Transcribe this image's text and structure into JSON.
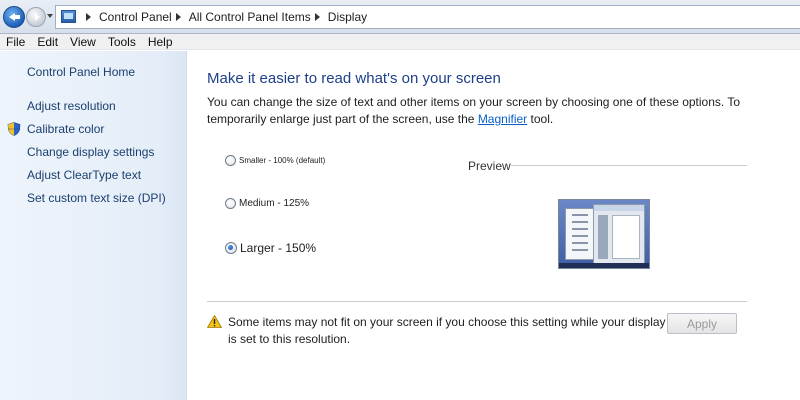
{
  "address_bar": {
    "breadcrumbs": [
      "Control Panel",
      "All Control Panel Items",
      "Display"
    ]
  },
  "menu": [
    "File",
    "Edit",
    "View",
    "Tools",
    "Help"
  ],
  "sidebar": {
    "home": "Control Panel Home",
    "links": [
      {
        "label": "Adjust resolution",
        "icon": ""
      },
      {
        "label": "Calibrate color",
        "icon": "uac-shield-icon"
      },
      {
        "label": "Change display settings",
        "icon": ""
      },
      {
        "label": "Adjust ClearType text",
        "icon": ""
      },
      {
        "label": "Set custom text size (DPI)",
        "icon": ""
      }
    ]
  },
  "main": {
    "title": "Make it easier to read what's on your screen",
    "description_before": "You can change the size of text and other items on your screen by choosing one of these options. To temporarily enlarge just part of the screen, use the ",
    "description_link": "Magnifier",
    "description_after": " tool.",
    "options": [
      {
        "label": "Smaller - 100% (default)",
        "checked": false
      },
      {
        "label": "Medium - 125%",
        "checked": false
      },
      {
        "label": "Larger - 150%",
        "checked": true
      }
    ],
    "preview_label": "Preview",
    "warning": "Some items may not fit on your screen if you choose this setting while your display is set to this resolution.",
    "apply_label": "Apply",
    "apply_enabled": false
  },
  "colors": {
    "title": "#1e3f8a",
    "link": "#0a5fcb",
    "sidebar_link": "#1b3f6e",
    "sidebar_bg": "#e4edf8"
  }
}
